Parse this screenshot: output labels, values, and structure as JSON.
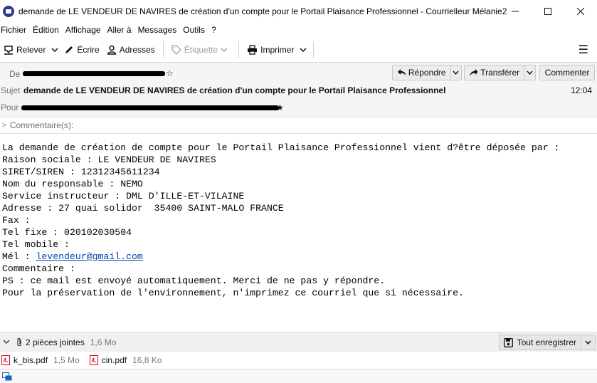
{
  "window": {
    "title": "demande de LE VENDEUR DE NAVIRES de création d'un compte pour le Portail Plaisance Professionnel - Courrielleur Mélanie2",
    "app_icon_text": "",
    "minimize": "—",
    "maximize": "☐",
    "close": "✕"
  },
  "menu": [
    "Fichier",
    "Édition",
    "Affichage",
    "Aller à",
    "Messages",
    "Outils",
    "?"
  ],
  "toolbar": {
    "get_label": "Relever",
    "write_label": "Écrire",
    "addresses_label": "Adresses",
    "tag_label": "Étiquette",
    "print_label": "Imprimer",
    "menu_glyph": "☰"
  },
  "header": {
    "from_label": "De",
    "subject_label": "Sujet",
    "to_label": "Pour",
    "subject": "demande de LE VENDEUR DE NAVIRES de création d'un compte pour le Portail Plaisance Professionnel",
    "time": "12:04",
    "reply_label": "Répondre",
    "forward_label": "Transférer",
    "comment_label": "Commenter",
    "comments_row": "Commentaire(s):"
  },
  "body": {
    "lines": [
      "La demande de création de compte pour le Portail Plaisance Professionnel vient d?être déposée par :",
      "Raison sociale : LE VENDEUR DE NAVIRES",
      "SIRET/SIREN : 12312345611234",
      "Nom du responsable : NEMO",
      "Service instructeur : DML D'ILLE-ET-VILAINE",
      "Adresse : 27 quai solidor  35400 SAINT-MALO FRANCE",
      "Fax :",
      "Tel fixe : 020102030504",
      "Tel mobile :",
      "Mél : ",
      "Commentaire :",
      "",
      "PS : ce mail est envoyé automatiquement. Merci de ne pas y répondre.",
      "Pour la préservation de l'environnement, n'imprimez ce courriel que si nécessaire."
    ],
    "email_link": "levendeur@gmail.com"
  },
  "attachments": {
    "count_label": "2 pièces jointes",
    "total_size": "1,6 Mo",
    "save_all_label": "Tout enregistrer",
    "items": [
      {
        "name": "k_bis.pdf",
        "size": "1,5 Mo"
      },
      {
        "name": "cin.pdf",
        "size": "16,8 Ko"
      }
    ]
  },
  "colors": {
    "link": "#0645ad",
    "pdf_red": "#d70022",
    "header_bg": "#f5f5f5"
  }
}
